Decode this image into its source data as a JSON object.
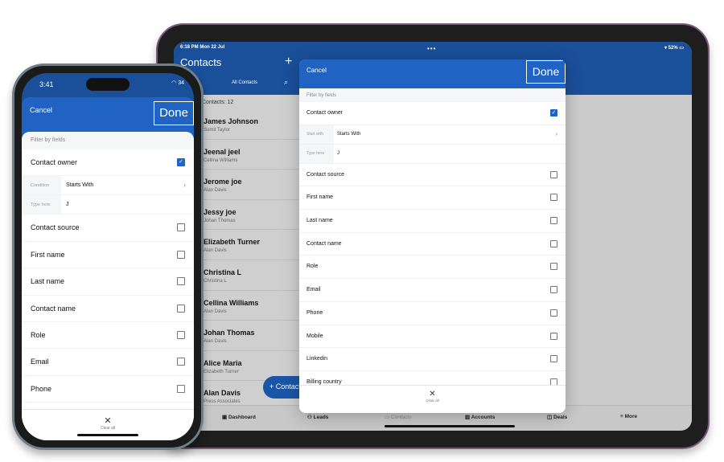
{
  "tablet": {
    "status_time": "6:18 PM  Mon 22 Jul",
    "status_right": "52%",
    "title": "Contacts",
    "view_selector": "All Contacts",
    "count_label": "Contacts: 12",
    "contacts": [
      {
        "name": "James Johnson",
        "owner": "Sumit Taylor"
      },
      {
        "name": "Jeenal jeel",
        "owner": "Cellina Williams"
      },
      {
        "name": "Jerome joe",
        "owner": "Alan Davis"
      },
      {
        "name": "Jessy joe",
        "owner": "Johan Thomas"
      },
      {
        "name": "Elizabeth Turner",
        "owner": "Alan Davis"
      },
      {
        "name": "Christina L",
        "owner": "Christina L"
      },
      {
        "name": "Cellina Williams",
        "owner": "Alan Davis"
      },
      {
        "name": "Johan Thomas",
        "owner": "Alan Davis"
      },
      {
        "name": "Alice Maria",
        "owner": "Elizabeth Turner"
      },
      {
        "name": "Alan Davis",
        "owner": "Press Associates"
      }
    ],
    "fab_label": "+ Contact",
    "tabs": [
      "Dashboard",
      "Leads",
      "Contacts",
      "Accounts",
      "Deals",
      "More"
    ],
    "modal": {
      "cancel": "Cancel",
      "done": "Done",
      "filter_heading": "Filter by fields",
      "owner_field": "Contact owner",
      "condition_label": "Start with",
      "condition_value": "Starts With",
      "input_label": "Type here",
      "input_value": "J",
      "fields": [
        "Contact source",
        "First name",
        "Last name",
        "Contact name",
        "Role",
        "Email",
        "Phone",
        "Mobile",
        "Linkedin",
        "Billing country"
      ],
      "clear_all": "Clear all"
    }
  },
  "phone": {
    "status_time": "3:41",
    "battery": "34",
    "cancel": "Cancel",
    "done": "Done",
    "filter_heading": "Filter by fields",
    "owner_field": "Contact owner",
    "condition_label": "Condition",
    "condition_value": "Starts With",
    "input_label": "Type here",
    "input_value": "J",
    "fields": [
      "Contact source",
      "First name",
      "Last name",
      "Contact name",
      "Role",
      "Email",
      "Phone"
    ],
    "clear_all": "Clear all"
  },
  "colors": {
    "brand_blue": "#2163c2",
    "header_blue": "#1a4f9a"
  }
}
